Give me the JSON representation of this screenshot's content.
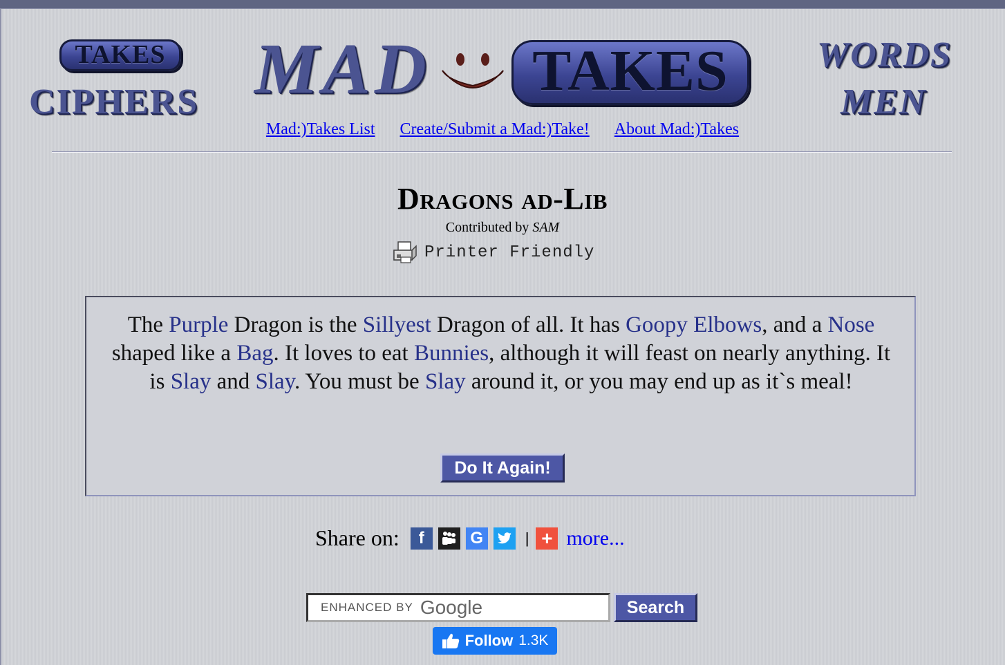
{
  "header": {
    "logo_left": {
      "pill": "TAKES",
      "word": "CIPHERS"
    },
    "logo_center": {
      "word": "MAD",
      "pill": "TAKES"
    },
    "logo_right": {
      "word1": "WORDS",
      "word2": "MEN"
    },
    "nav": [
      {
        "label": "Mad:)Takes List"
      },
      {
        "label": "Create/Submit a Mad:)Take!"
      },
      {
        "label": "About Mad:)Takes"
      }
    ]
  },
  "article": {
    "title": "Dragons ad-Lib",
    "contributed_prefix": "Contributed by",
    "author": "SAM",
    "printer_label": "Printer Friendly"
  },
  "story": {
    "parts": [
      {
        "t": "The ",
        "fill": false
      },
      {
        "t": "Purple",
        "fill": true
      },
      {
        "t": " Dragon is the ",
        "fill": false
      },
      {
        "t": "Sillyest",
        "fill": true
      },
      {
        "t": " Dragon of all. It has ",
        "fill": false
      },
      {
        "t": "Goopy",
        "fill": true
      },
      {
        "t": " ",
        "fill": false
      },
      {
        "t": "Elbows",
        "fill": true
      },
      {
        "t": ", and a ",
        "fill": false
      },
      {
        "t": "Nose",
        "fill": true
      },
      {
        "t": " shaped like a ",
        "fill": false
      },
      {
        "t": "Bag",
        "fill": true
      },
      {
        "t": ". It loves to eat ",
        "fill": false
      },
      {
        "t": "Bunnies",
        "fill": true
      },
      {
        "t": ", although it will feast on nearly anything. It is ",
        "fill": false
      },
      {
        "t": "Slay",
        "fill": true
      },
      {
        "t": " and ",
        "fill": false
      },
      {
        "t": "Slay",
        "fill": true
      },
      {
        "t": ". You must be ",
        "fill": false
      },
      {
        "t": "Slay",
        "fill": true
      },
      {
        "t": " around it, or you may end up as it`s meal!",
        "fill": false
      }
    ],
    "button_label": "Do It Again!"
  },
  "share": {
    "label": "Share on:",
    "icons": [
      {
        "name": "facebook-icon",
        "glyph": "f",
        "color": "#3b5998"
      },
      {
        "name": "myspace-icon",
        "glyph": "",
        "color": "#1f1f1f"
      },
      {
        "name": "google-icon",
        "glyph": "G",
        "color": "#4285f4"
      },
      {
        "name": "twitter-icon",
        "glyph": "",
        "color": "#1da1f2"
      }
    ],
    "separator": "|",
    "add_color": "#f0513d",
    "more_label": "more..."
  },
  "search": {
    "placeholder_prefix": "ENHANCED BY",
    "placeholder_brand": "Google",
    "button_label": "Search"
  },
  "follow": {
    "label": "Follow",
    "count": "1.3K",
    "color": "#1877f2"
  },
  "colors": {
    "background": "#cfd1d6",
    "fill_word": "#27318a",
    "button": "#4d57a5",
    "link": "#0000ee"
  }
}
